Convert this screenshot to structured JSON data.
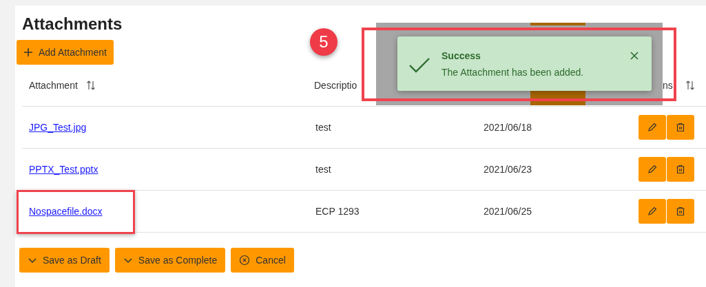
{
  "title": "Attachments",
  "add_button": {
    "label": "Add Attachment"
  },
  "table": {
    "columns": [
      {
        "label": "Attachment",
        "sortable": true
      },
      {
        "label": "Descriptio",
        "sortable": false
      },
      {
        "label": "ns",
        "sortable": true
      }
    ],
    "rows": [
      {
        "attachment": "JPG_Test.jpg",
        "description": "test",
        "date": "2021/06/18",
        "highlighted": false
      },
      {
        "attachment": "PPTX_Test.pptx",
        "description": "test",
        "date": "2021/06/23",
        "highlighted": false
      },
      {
        "attachment": "Nospacefile.docx",
        "description": "ECP 1293",
        "date": "2021/06/25",
        "highlighted": true
      }
    ]
  },
  "toast": {
    "title": "Success",
    "message": "The Attachment has been added."
  },
  "step_badge": "5",
  "footer_buttons": [
    {
      "label": "Save as Draft",
      "kind": "chevron"
    },
    {
      "label": "Save as Complete",
      "kind": "chevron"
    },
    {
      "label": "Cancel",
      "kind": "cancel"
    }
  ]
}
